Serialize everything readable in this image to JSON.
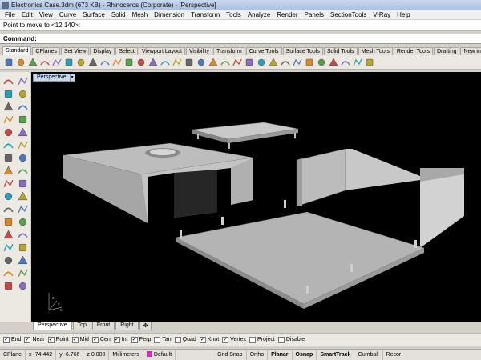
{
  "window": {
    "title": "Electronics Case.3dm (673 KB) - Rhinoceros (Corporate) - [Perspective]"
  },
  "menu": [
    "File",
    "Edit",
    "View",
    "Curve",
    "Surface",
    "Solid",
    "Mesh",
    "Dimension",
    "Transform",
    "Tools",
    "Analyze",
    "Render",
    "Panels",
    "SectionTools",
    "V-Ray",
    "Help"
  ],
  "command": {
    "history": "Point to move to <12.140>:",
    "label": "Command:",
    "value": ""
  },
  "toolbar_tabs": [
    "Standard",
    "CPlanes",
    "Set View",
    "Display",
    "Select",
    "Viewport Layout",
    "Visibility",
    "Transform",
    "Curve Tools",
    "Surface Tools",
    "Solid Tools",
    "Mesh Tools",
    "Render Tools",
    "Drafting",
    "New in V5"
  ],
  "toolbar_icons": [
    "new-file-icon",
    "open-folder-icon",
    "save-icon",
    "print-icon",
    "import-icon",
    "cut-icon",
    "copy-icon",
    "paste-icon",
    "undo-icon",
    "pan-icon",
    "rotate-view-icon",
    "zoom-icon",
    "zoom-window-icon",
    "zoom-extents-icon",
    "zoom-selected-icon",
    "zoom-all-icon",
    "undo-view-icon",
    "grid-icon",
    "layers-icon",
    "car-icon",
    "properties-icon",
    "lightbulb-icon",
    "select-icon",
    "paint-icon",
    "render-icon",
    "wireframe-sphere-icon",
    "shaded-sphere-icon",
    "rendered-sphere-icon",
    "gear-icon",
    "tools-icon",
    "help-icon"
  ],
  "left_tools": [
    "point-icon",
    "point-cloud-icon",
    "polyline-icon",
    "curve-icon",
    "circle-icon",
    "arc-icon",
    "ellipse-icon",
    "rectangle-icon",
    "polygon-icon",
    "free-curve-icon",
    "offset-icon",
    "fillet-curve-icon",
    "surface-icon",
    "extrude-icon",
    "box-icon",
    "sphere-icon",
    "boolean-icon",
    "mesh-icon",
    "split-icon",
    "trim-icon",
    "explode-icon",
    "join-icon",
    "move-icon",
    "copy-tool-icon",
    "rotate-icon",
    "scale-icon",
    "array-icon",
    "mirror-icon",
    "dimension-icon",
    "text-icon",
    "analyze-icon",
    "render-tool-icon",
    "layer-tool-icon",
    "check-icon"
  ],
  "viewport": {
    "name": "Perspective"
  },
  "viewport_tabs": [
    "Perspective",
    "Top",
    "Front",
    "Right"
  ],
  "osnaps": [
    {
      "label": "End",
      "checked": true
    },
    {
      "label": "Near",
      "checked": true
    },
    {
      "label": "Point",
      "checked": true
    },
    {
      "label": "Mid",
      "checked": true
    },
    {
      "label": "Cen",
      "checked": true
    },
    {
      "label": "Int",
      "checked": true
    },
    {
      "label": "Perp",
      "checked": true
    },
    {
      "label": "Tan",
      "checked": false
    },
    {
      "label": "Quad",
      "checked": false
    },
    {
      "label": "Knot",
      "checked": true
    },
    {
      "label": "Vertex",
      "checked": true
    },
    {
      "label": "Project",
      "checked": false
    },
    {
      "label": "Disable",
      "checked": false
    }
  ],
  "status": {
    "cplane": "CPlane",
    "x": "x -74.442",
    "y": "y -6.766",
    "z": "z 0.000",
    "units": "Millimeters",
    "layer": "Default",
    "layer_color": "#e020c0",
    "grid_snap": "Grid Snap",
    "ortho": "Ortho",
    "planar": "Planar",
    "osnap": "Osnap",
    "smarttrack": "SmartTrack",
    "gumball": "Gumball",
    "record": "Recor"
  }
}
